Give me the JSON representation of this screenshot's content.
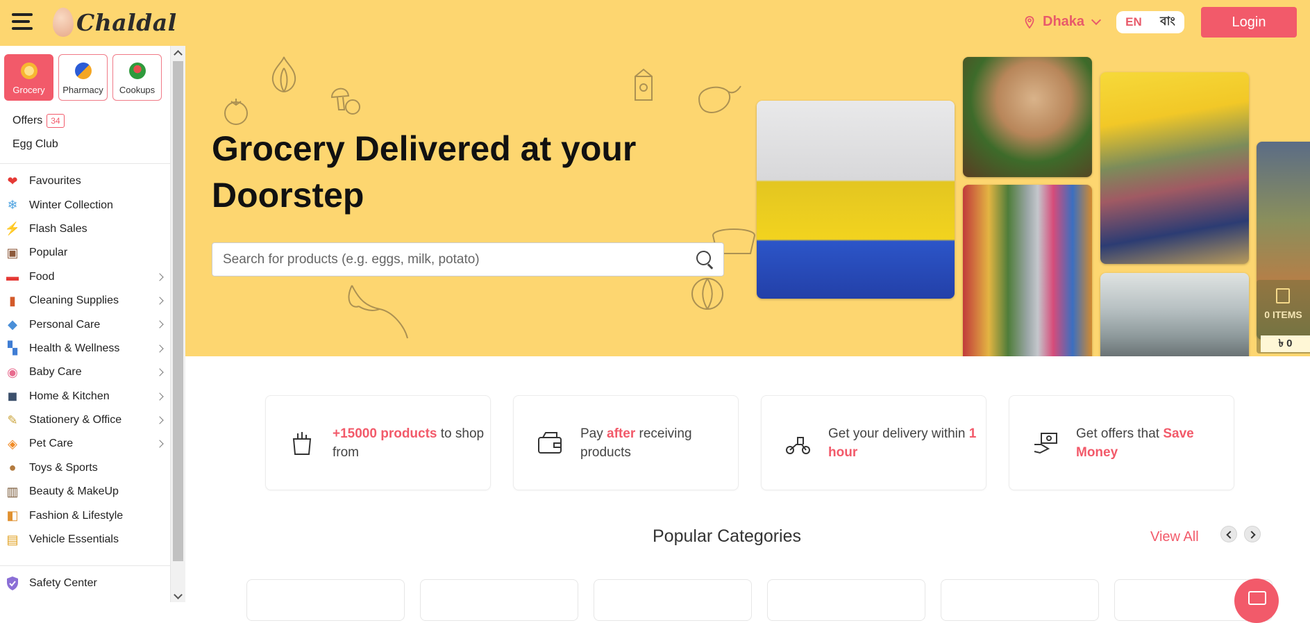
{
  "header": {
    "logo_text": "Chaldal",
    "location": "Dhaka",
    "lang_en": "EN",
    "lang_bn": "বাং",
    "login_label": "Login"
  },
  "sidebar": {
    "verticals": [
      {
        "label": "Grocery",
        "icon": "grocery-icon",
        "active": true
      },
      {
        "label": "Pharmacy",
        "icon": "pharmacy-icon",
        "active": false
      },
      {
        "label": "Cookups",
        "icon": "cookups-icon",
        "active": false
      }
    ],
    "offers_label": "Offers",
    "offers_count": "34",
    "egg_club_label": "Egg Club",
    "categories": [
      {
        "label": "Favourites",
        "icon": "heart-icon",
        "glyph": "❤",
        "has_children": false
      },
      {
        "label": "Winter Collection",
        "icon": "snowflake-icon",
        "glyph": "❄",
        "has_children": false
      },
      {
        "label": "Flash Sales",
        "icon": "lightning-icon",
        "glyph": "⚡",
        "has_children": false
      },
      {
        "label": "Popular",
        "icon": "popular-icon",
        "glyph": "▣",
        "has_children": false
      },
      {
        "label": "Food",
        "icon": "food-basket-icon",
        "glyph": "▬",
        "has_children": true
      },
      {
        "label": "Cleaning Supplies",
        "icon": "cleaning-icon",
        "glyph": "▮",
        "has_children": true
      },
      {
        "label": "Personal Care",
        "icon": "personal-care-icon",
        "glyph": "◆",
        "has_children": true
      },
      {
        "label": "Health & Wellness",
        "icon": "health-icon",
        "glyph": "▚",
        "has_children": true
      },
      {
        "label": "Baby Care",
        "icon": "baby-care-icon",
        "glyph": "◉",
        "has_children": true
      },
      {
        "label": "Home & Kitchen",
        "icon": "home-kitchen-icon",
        "glyph": "◼",
        "has_children": true
      },
      {
        "label": "Stationery & Office",
        "icon": "stationery-icon",
        "glyph": "✎",
        "has_children": true
      },
      {
        "label": "Pet Care",
        "icon": "pet-care-icon",
        "glyph": "◈",
        "has_children": true
      },
      {
        "label": "Toys & Sports",
        "icon": "toys-icon",
        "glyph": "●",
        "has_children": false
      },
      {
        "label": "Beauty & MakeUp",
        "icon": "beauty-icon",
        "glyph": "▥",
        "has_children": false
      },
      {
        "label": "Fashion & Lifestyle",
        "icon": "fashion-icon",
        "glyph": "◧",
        "has_children": false
      },
      {
        "label": "Vehicle Essentials",
        "icon": "vehicle-icon",
        "glyph": "▤",
        "has_children": false
      }
    ],
    "safety_label": "Safety Center"
  },
  "hero": {
    "title": "Grocery Delivered at your Doorstep",
    "search_placeholder": "Search for products (e.g. eggs, milk, potato)"
  },
  "cart": {
    "items_label": "0 ITEMS",
    "total": "৳ 0"
  },
  "features": [
    {
      "highlight": "+15000 products",
      "text_after": " to shop from",
      "text_before": "",
      "icon": "grocery-bag-icon"
    },
    {
      "text_before": "Pay ",
      "highlight": "after",
      "text_after": " receiving products",
      "icon": "wallet-icon"
    },
    {
      "text_before": "Get your delivery within ",
      "highlight": "1 hour",
      "text_after": "",
      "icon": "delivery-scooter-icon"
    },
    {
      "text_before": "Get offers that ",
      "highlight": "Save Money",
      "text_after": "",
      "icon": "money-hand-icon"
    }
  ],
  "popular": {
    "title": "Popular Categories",
    "view_all": "View All"
  },
  "colors": {
    "brand_yellow": "#fdd670",
    "accent_red": "#f25a6a"
  }
}
